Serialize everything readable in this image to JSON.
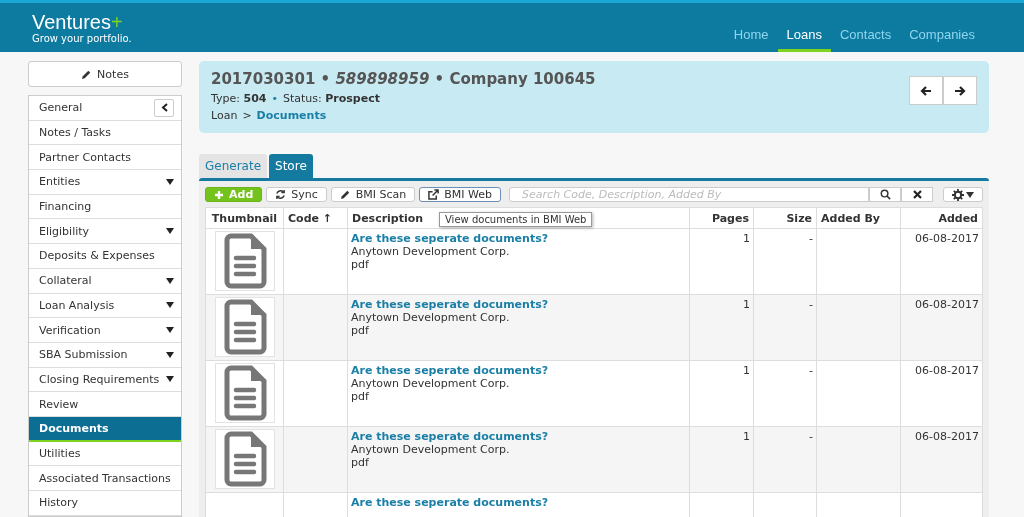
{
  "brand": {
    "name": "Ventures",
    "mark": "+",
    "tagline": "Grow your portfolio."
  },
  "nav": [
    {
      "label": "Home",
      "selected": false
    },
    {
      "label": "Loans",
      "selected": true
    },
    {
      "label": "Contacts",
      "selected": false
    },
    {
      "label": "Companies",
      "selected": false
    }
  ],
  "sidebar": {
    "notes_button": "Notes",
    "items": [
      {
        "label": "General",
        "expandable": false,
        "selected": false,
        "collapse_button": true
      },
      {
        "label": "Notes / Tasks",
        "expandable": false,
        "selected": false
      },
      {
        "label": "Partner Contacts",
        "expandable": false,
        "selected": false
      },
      {
        "label": "Entities",
        "expandable": true,
        "selected": false
      },
      {
        "label": "Financing",
        "expandable": false,
        "selected": false
      },
      {
        "label": "Eligibility",
        "expandable": true,
        "selected": false
      },
      {
        "label": "Deposits & Expenses",
        "expandable": false,
        "selected": false
      },
      {
        "label": "Collateral",
        "expandable": true,
        "selected": false
      },
      {
        "label": "Loan Analysis",
        "expandable": true,
        "selected": false
      },
      {
        "label": "Verification",
        "expandable": true,
        "selected": false
      },
      {
        "label": "SBA Submission",
        "expandable": true,
        "selected": false
      },
      {
        "label": "Closing Requirements",
        "expandable": true,
        "selected": false
      },
      {
        "label": "Review",
        "expandable": false,
        "selected": false
      },
      {
        "label": "Documents",
        "expandable": false,
        "selected": true
      },
      {
        "label": "Utilities",
        "expandable": false,
        "selected": false
      },
      {
        "label": "Associated Transactions",
        "expandable": false,
        "selected": false
      },
      {
        "label": "History",
        "expandable": false,
        "selected": false
      }
    ]
  },
  "loan": {
    "number": "2017030301",
    "code": "589898959",
    "company": "Company 100645",
    "type_label": "Type:",
    "type": "504",
    "status_label": "Status:",
    "status": "Prospect",
    "breadcrumb": [
      {
        "label": "Loan",
        "link": false
      },
      {
        "label": "Documents",
        "link": true
      }
    ],
    "breadcrumb_separator": ">",
    "separator": "•"
  },
  "tabs": [
    {
      "label": "Generate",
      "selected": false
    },
    {
      "label": "Store",
      "selected": true
    }
  ],
  "toolbar": {
    "buttons": [
      {
        "label": "Add",
        "kind": "add"
      },
      {
        "label": "Sync",
        "kind": "sync"
      },
      {
        "label": "BMI Scan",
        "kind": "scan"
      },
      {
        "label": "BMI Web",
        "kind": "web"
      }
    ],
    "search": {
      "placeholder": "Search Code, Description, Added By"
    },
    "tooltip": "View documents in BMI Web"
  },
  "table": {
    "columns": [
      {
        "label": "Thumbnail"
      },
      {
        "label": "Code",
        "sort_mark": "↑"
      },
      {
        "label": "Description"
      },
      {
        "label": "Pages"
      },
      {
        "label": "Size"
      },
      {
        "label": "Added By"
      },
      {
        "label": "Added"
      }
    ],
    "rows": [
      {
        "title": "Are these seperate documents?",
        "company": "Anytown Development Corp.",
        "format": "pdf",
        "pages": "1",
        "size": "-",
        "added": "06-08-2017"
      },
      {
        "title": "Are these seperate documents?",
        "company": "Anytown Development Corp.",
        "format": "pdf",
        "pages": "1",
        "size": "-",
        "added": "06-08-2017"
      },
      {
        "title": "Are these seperate documents?",
        "company": "Anytown Development Corp.",
        "format": "pdf",
        "pages": "1",
        "size": "-",
        "added": "06-08-2017"
      },
      {
        "title": "Are these seperate documents?",
        "company": "Anytown Development Corp.",
        "format": "pdf",
        "pages": "1",
        "size": "-",
        "added": "06-08-2017"
      },
      {
        "title": "Are these seperate documents?"
      }
    ]
  }
}
